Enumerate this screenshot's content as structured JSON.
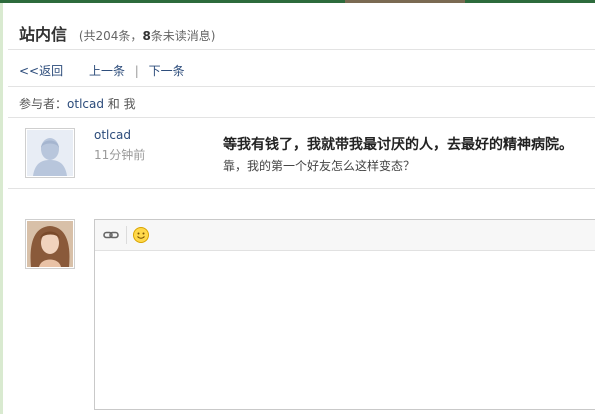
{
  "header": {
    "title": "站内信",
    "count_prefix": "(共204条，",
    "unread_count": "8",
    "count_suffix": "条未读消息)"
  },
  "nav": {
    "back": "<<返回",
    "prev": "上一条",
    "separator": "|",
    "next": "下一条"
  },
  "participants": {
    "label": "参与者：",
    "user": "otlcad",
    "connector": " 和 ",
    "me": "我"
  },
  "message": {
    "sender": "otlcad",
    "time": "11分钟前",
    "title": "等我有钱了，我就带我最讨厌的人，去最好的精神病院。",
    "body": "靠，我的第一个好友怎么这样变态？"
  },
  "reply": {
    "toolbar": [
      {
        "icon": "link-icon"
      },
      {
        "icon": "smiley-icon"
      }
    ],
    "value": ""
  },
  "colors": {
    "link": "#2b4b7a",
    "top_band": "#2d6b3c"
  }
}
